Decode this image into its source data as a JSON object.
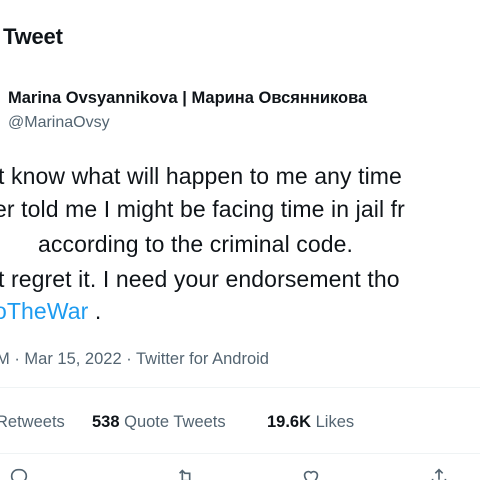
{
  "header": {
    "title": "Tweet"
  },
  "tweet": {
    "display_name": "Marina Ovsyannikova | Марина Овсянникова",
    "handle": "@MarinaOvsy",
    "lines": [
      "t know what will happen to me any time",
      "er told me I might be facing time in jail fr",
      "according to the criminal code.",
      "t regret it. I need your endorsement tho"
    ],
    "hashtag": "oTheWar",
    "hashtag_suffix": " .",
    "meta": "M · Mar 15, 2022 · Twitter for Android"
  },
  "stats": {
    "retweets_label": "Retweets",
    "quote_count": "538",
    "quote_label": "Quote Tweets",
    "likes_count": "19.6K",
    "likes_label": "Likes"
  },
  "actions": {
    "icons": [
      "reply-icon",
      "retweet-icon",
      "like-icon",
      "share-icon"
    ]
  }
}
